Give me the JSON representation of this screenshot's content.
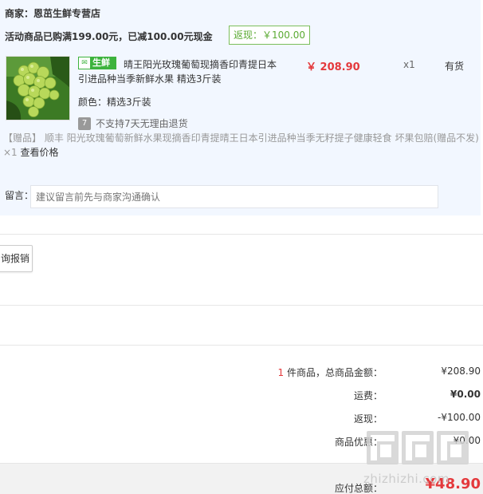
{
  "shop": {
    "text": "商家：恩茁生鲜专营店"
  },
  "promo": {
    "text": "活动商品已购满199.00元，已减100.00元现金",
    "rebate_badge": "返现：￥100.00"
  },
  "product": {
    "tag": "生鲜",
    "title": "晴王阳光玫瑰葡萄现摘香印青提日本引进品种当季新鲜水果 精选3斤装",
    "price": "￥ 208.90",
    "qty": "x1",
    "stock": "有货",
    "spec": "颜色：精选3斤装",
    "return_policy": "不支持7天无理由退货",
    "return_icon": "7"
  },
  "gift": {
    "text": "【赠品】  顺丰 阳光玫瑰葡萄新鲜水果现摘香印青提晴王日本引进品种当季无籽提子健康轻食 坏果包赔(赠品不发) ×1",
    "link": "查看价格"
  },
  "message": {
    "label": "留言：",
    "placeholder": "建议留言前先与商家沟通确认"
  },
  "report_button": "询报销",
  "summary": {
    "count": "1",
    "count_suffix": " 件商品，总商品金额：",
    "goods_total": "¥208.90",
    "shipping_label": "运费：",
    "shipping_value": "¥0.00",
    "rebate_label": "返现：",
    "rebate_value": "-¥100.00",
    "discount_label": "商品优惠：",
    "discount_value": "¥0.00",
    "payable_label": "应付总额：",
    "payable_value": "¥48.90"
  },
  "watermark": {
    "text": "zhizhizhi.com"
  },
  "colors": {
    "accent_red": "#e4393c",
    "fresh_green": "#3db33d",
    "panel_bg": "#f2f7ff"
  }
}
